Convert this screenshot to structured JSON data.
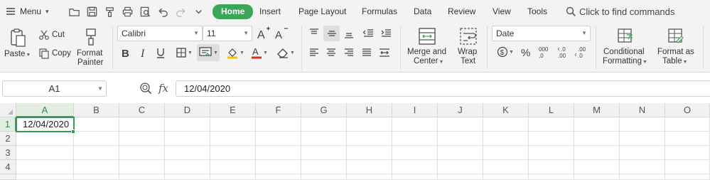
{
  "menubar": {
    "menu_label": "Menu",
    "quick_access": [
      "folder-icon",
      "save-icon",
      "format-painter-icon",
      "print-icon",
      "print-preview-icon",
      "undo-icon",
      "redo-icon",
      "customize-icon"
    ],
    "tabs": [
      {
        "label": "Home",
        "active": true
      },
      {
        "label": "Insert"
      },
      {
        "label": "Page Layout"
      },
      {
        "label": "Formulas"
      },
      {
        "label": "Data"
      },
      {
        "label": "Review"
      },
      {
        "label": "View"
      },
      {
        "label": "Tools"
      }
    ],
    "search_text": "Click to find commands",
    "accent_color": "#3aa658"
  },
  "ribbon": {
    "paste_label": "Paste",
    "cut_label": "Cut",
    "copy_label": "Copy",
    "format_painter_label_1": "Format",
    "format_painter_label_2": "Painter",
    "font_name": "Calibri",
    "font_size": "11",
    "merge_label_1": "Merge and",
    "merge_label_2": "Center",
    "wrap_label_1": "Wrap",
    "wrap_label_2": "Text",
    "number_format": "Date",
    "conditional_label_1": "Conditional",
    "conditional_label_2": "Formatting",
    "format_table_label_1": "Format as",
    "format_table_label_2": "Table",
    "font_color": "#d93025",
    "fill_color": "#f2c200"
  },
  "formula_bar": {
    "name_box": "A1",
    "fx_label": "fx",
    "formula": "12/04/2020"
  },
  "sheet": {
    "columns": [
      "A",
      "B",
      "C",
      "D",
      "E",
      "F",
      "G",
      "H",
      "I",
      "J",
      "K",
      "L",
      "M",
      "N",
      "O"
    ],
    "rows": [
      "1",
      "2",
      "3",
      "4"
    ],
    "selected_cell": "A1",
    "cells": {
      "A1": "12/04/2020"
    }
  }
}
